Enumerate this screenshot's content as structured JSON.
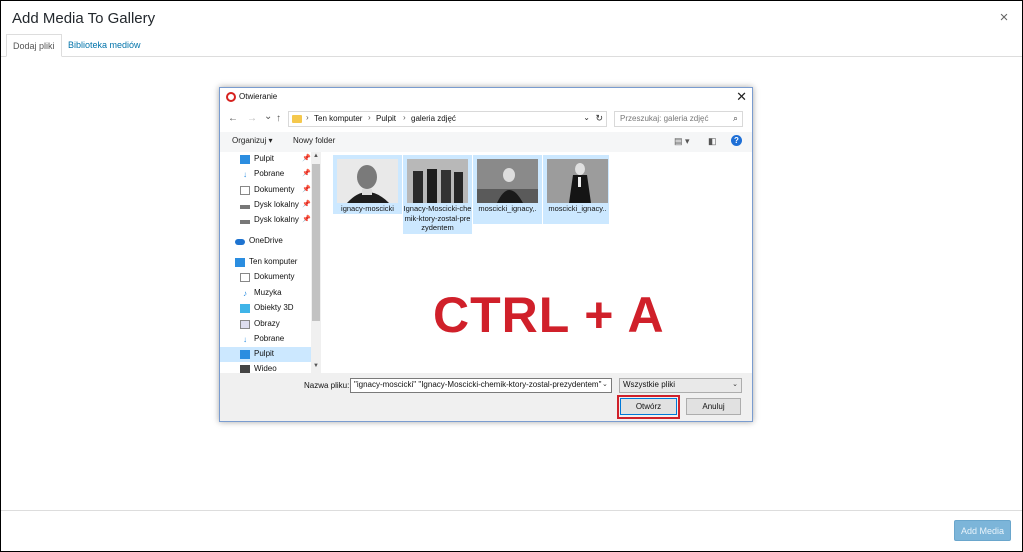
{
  "modal": {
    "title": "Add Media To Gallery",
    "close_glyph": "×",
    "tabs": [
      {
        "label": "Dodaj pliki",
        "active": true
      },
      {
        "label": "Biblioteka mediów",
        "active": false
      }
    ],
    "add_media_label": "Add Media"
  },
  "dialog": {
    "title": "Otwieranie",
    "close_glyph": "✕",
    "nav": {
      "back": "←",
      "forward": "→",
      "recent": "⌄",
      "up": "↑"
    },
    "breadcrumb": [
      "Ten komputer",
      "Pulpit",
      "galeria zdjęć"
    ],
    "breadcrumb_sep": "›",
    "search_placeholder": "Przeszukaj: galeria zdjęć",
    "toolbar": {
      "organize": "Organizuj ▾",
      "new_folder": "Nowy folder",
      "help": "?"
    },
    "sidebar": [
      {
        "label": "Pulpit",
        "icon": "desktop-icon",
        "pinned": true,
        "selected": false
      },
      {
        "label": "Pobrane",
        "icon": "download-icon",
        "pinned": true,
        "selected": false
      },
      {
        "label": "Dokumenty",
        "icon": "document-icon",
        "pinned": true,
        "selected": false
      },
      {
        "label": "Dysk lokalny",
        "icon": "drive-icon",
        "pinned": true,
        "selected": false
      },
      {
        "label": "Dysk lokalny",
        "icon": "drive-icon",
        "pinned": true,
        "selected": false
      },
      {
        "label": "OneDrive",
        "icon": "cloud-icon",
        "pinned": false,
        "selected": false
      },
      {
        "label": "Ten komputer",
        "icon": "computer-icon",
        "pinned": false,
        "selected": false
      },
      {
        "label": "Dokumenty",
        "icon": "document-icon",
        "pinned": false,
        "selected": false
      },
      {
        "label": "Muzyka",
        "icon": "music-icon",
        "pinned": false,
        "selected": false
      },
      {
        "label": "Obiekty 3D",
        "icon": "cube-icon",
        "pinned": false,
        "selected": false
      },
      {
        "label": "Obrazy",
        "icon": "image-icon",
        "pinned": false,
        "selected": false
      },
      {
        "label": "Pobrane",
        "icon": "download-icon",
        "pinned": false,
        "selected": false
      },
      {
        "label": "Pulpit",
        "icon": "desktop-icon",
        "pinned": false,
        "selected": true
      },
      {
        "label": "Wideo",
        "icon": "video-icon",
        "pinned": false,
        "selected": false
      }
    ],
    "files": [
      {
        "label": "ignacy-moscicki",
        "selected": true
      },
      {
        "label": "Ignacy-Moscicki-chemik-ktory-zostal-prezydentem",
        "selected": true
      },
      {
        "label": "moscicki_ignacy,.",
        "selected": true
      },
      {
        "label": "moscicki_ignacy..",
        "selected": true
      }
    ],
    "overlay_text": "CTRL + A",
    "filename_label": "Nazwa pliku:",
    "filename_value": "\"ignacy-moscicki\" \"Ignacy-Moscicki-chemik-ktory-zostal-prezydentem\"",
    "filter_value": "Wszystkie pliki",
    "open_label": "Otwórz",
    "cancel_label": "Anuluj"
  },
  "colors": {
    "accent_blue": "#0073aa",
    "highlight_red": "#d0202a",
    "selection": "#cce8ff"
  }
}
